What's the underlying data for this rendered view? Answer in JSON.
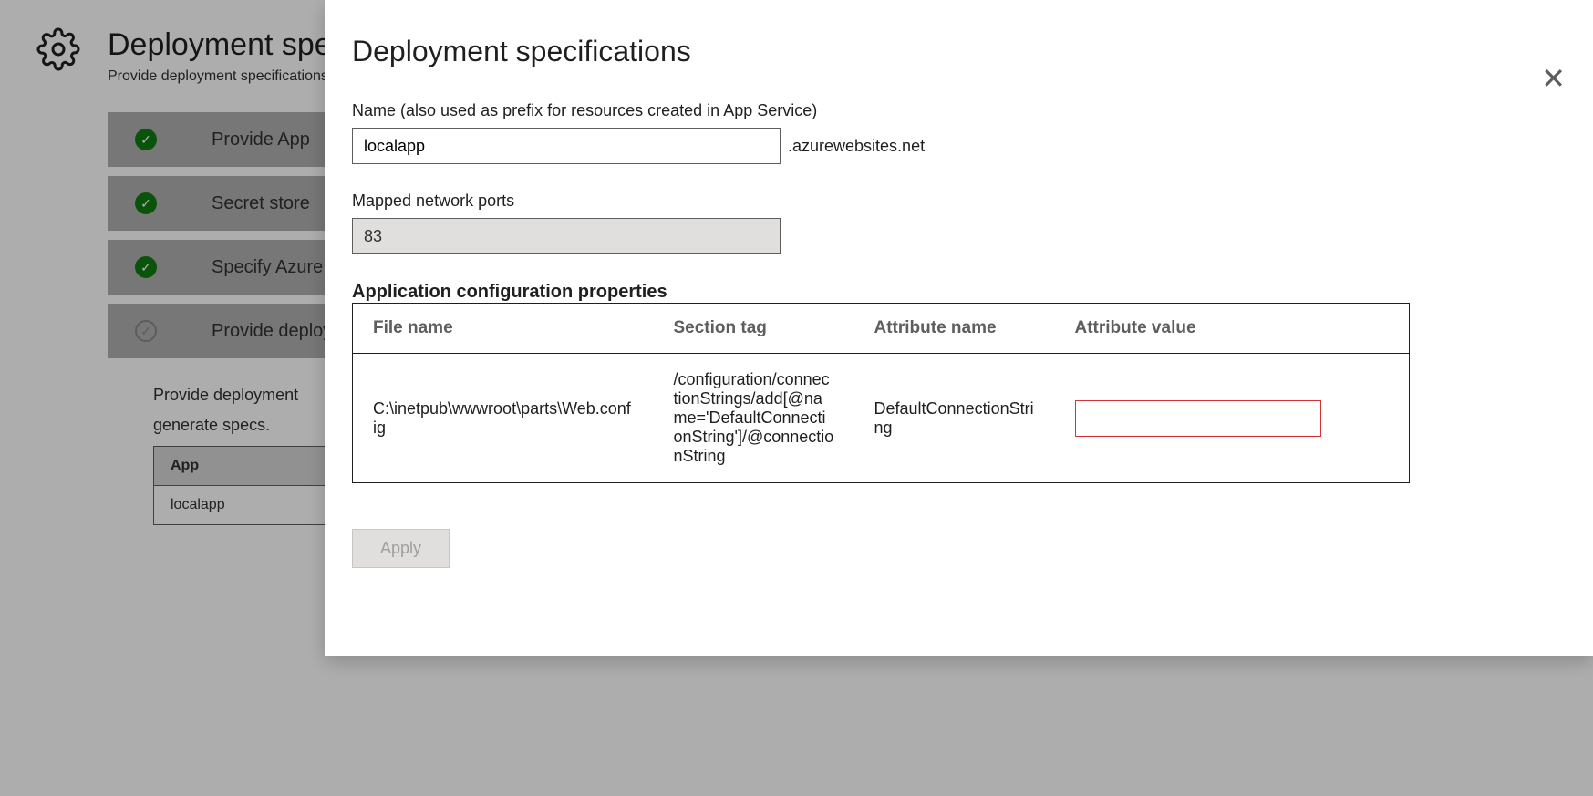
{
  "background": {
    "title": "Deployment specifications",
    "subtitle": "Provide deployment specifications",
    "steps": [
      {
        "label": "Provide App",
        "done": true
      },
      {
        "label": "Secret store",
        "done": true
      },
      {
        "label": "Specify Azure",
        "done": true
      },
      {
        "label": "Provide deployment",
        "done": false
      }
    ],
    "expand_text1": "Provide deployment",
    "expand_text2": "generate specs.",
    "table_header": "App",
    "table_cell": "localapp"
  },
  "modal": {
    "title": "Deployment specifications",
    "name_label": "Name (also used as prefix for resources created in App Service)",
    "name_value": "localapp",
    "suffix": ".azurewebsites.net",
    "ports_label": "Mapped network ports",
    "ports_value": "83",
    "props_header": "Application configuration properties",
    "table": {
      "columns": [
        "File name",
        "Section tag",
        "Attribute name",
        "Attribute value"
      ],
      "row": {
        "file": "C:\\inetpub\\wwwroot\\parts\\Web.config",
        "section": "/configuration/connectionStrings/add[@name='DefaultConnectionString']/@connectionString",
        "attr_name": "DefaultConnectionString",
        "attr_value": ""
      }
    },
    "apply_label": "Apply"
  }
}
